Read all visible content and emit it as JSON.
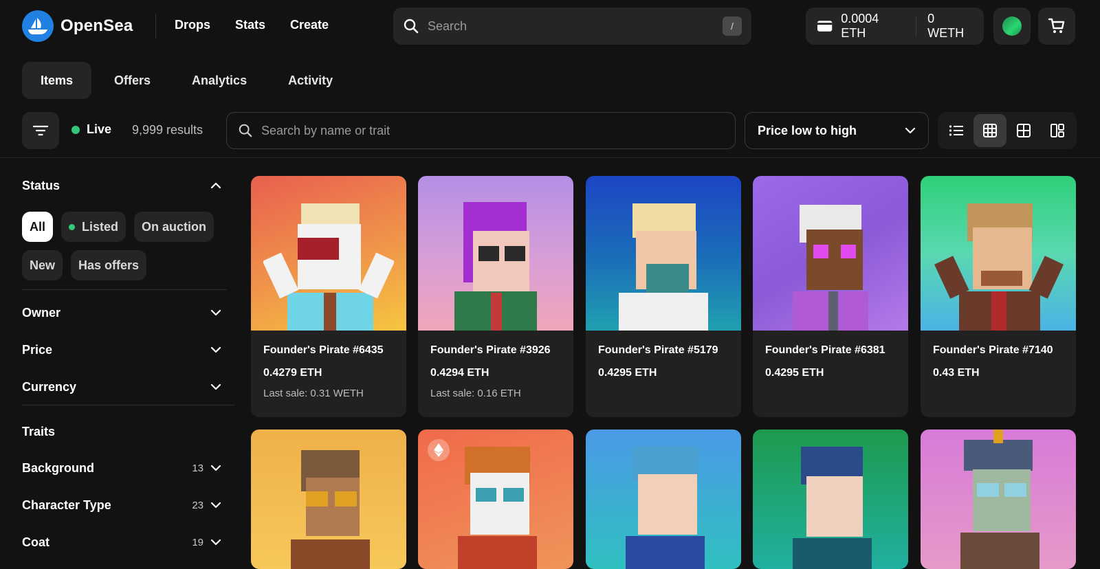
{
  "brand": {
    "name": "OpenSea",
    "accent": "#2081e2"
  },
  "nav": {
    "links": [
      "Drops",
      "Stats",
      "Create"
    ]
  },
  "global_search": {
    "placeholder": "Search",
    "shortcut": "/"
  },
  "wallet": {
    "eth_balance": "0.0004 ETH",
    "weth_balance": "0 WETH"
  },
  "tabs": [
    {
      "label": "Items",
      "active": true
    },
    {
      "label": "Offers",
      "active": false
    },
    {
      "label": "Analytics",
      "active": false
    },
    {
      "label": "Activity",
      "active": false
    }
  ],
  "toolbar": {
    "live_label": "Live",
    "results": "9,999 results",
    "search_placeholder": "Search by name or trait",
    "sort_label": "Price low to high",
    "view_modes": [
      "list",
      "grid-small",
      "grid-large",
      "gallery"
    ],
    "active_view": "grid-small"
  },
  "sidebar": {
    "status": {
      "title": "Status",
      "chips": [
        {
          "label": "All",
          "active": true
        },
        {
          "label": "Listed",
          "dot": true
        },
        {
          "label": "On auction"
        },
        {
          "label": "New"
        },
        {
          "label": "Has offers"
        }
      ]
    },
    "sections": [
      "Owner",
      "Price",
      "Currency"
    ],
    "traits_title": "Traits",
    "traits": [
      {
        "label": "Background",
        "count": "13"
      },
      {
        "label": "Character Type",
        "count": "23"
      },
      {
        "label": "Coat",
        "count": "19"
      }
    ]
  },
  "items": [
    {
      "title": "Founder's Pirate #6435",
      "price": "0.4279 ETH",
      "last_sale": "Last sale: 0.31 WETH"
    },
    {
      "title": "Founder's Pirate #3926",
      "price": "0.4294 ETH",
      "last_sale": "Last sale: 0.16 ETH"
    },
    {
      "title": "Founder's Pirate #5179",
      "price": "0.4295 ETH",
      "last_sale": ""
    },
    {
      "title": "Founder's Pirate #6381",
      "price": "0.4295 ETH",
      "last_sale": ""
    },
    {
      "title": "Founder's Pirate #7140",
      "price": "0.43 ETH",
      "last_sale": ""
    }
  ],
  "colors": {
    "live_green": "#34c77b",
    "background": "#121212",
    "card": "#212121"
  }
}
